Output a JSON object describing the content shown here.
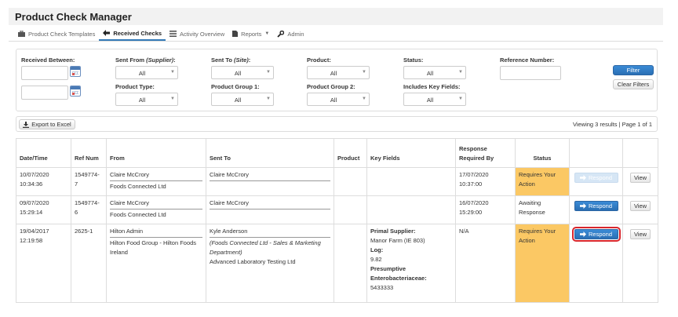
{
  "app": {
    "title": "Product Check Manager"
  },
  "nav": [
    {
      "label": "Product Check Templates",
      "icon": "briefcase-icon"
    },
    {
      "label": "Received Checks",
      "icon": "arrow-left-icon",
      "active": true
    },
    {
      "label": "Activity Overview",
      "icon": "list-icon"
    },
    {
      "label": "Reports",
      "icon": "file-icon",
      "dropdown": true
    },
    {
      "label": "Admin",
      "icon": "wrench-icon"
    }
  ],
  "filters": {
    "received_between": {
      "label": "Received Between:"
    },
    "sent_from": {
      "label": "Sent From ",
      "label_em": "(Supplier)",
      "label_tail": ":",
      "value": "All"
    },
    "sent_to": {
      "label": "Sent To ",
      "label_em": "(Site)",
      "label_tail": ":",
      "value": "All"
    },
    "product": {
      "label": "Product:",
      "value": "All"
    },
    "status": {
      "label": "Status:",
      "value": "All"
    },
    "reference_number": {
      "label": "Reference Number:",
      "value": ""
    },
    "product_type": {
      "label": "Product Type:",
      "value": "All"
    },
    "product_group_1": {
      "label": "Product Group 1:",
      "value": "All"
    },
    "product_group_2": {
      "label": "Product Group 2:",
      "value": "All"
    },
    "includes_key_fields": {
      "label": "Includes Key Fields:",
      "value": "All"
    },
    "filter_button": "Filter",
    "clear_button": "Clear Filters"
  },
  "toolbar": {
    "export_label": "Export to Excel",
    "results_info": "Viewing 3 results | Page 1 of 1"
  },
  "table": {
    "headers": {
      "datetime": "Date/Time",
      "ref": "Ref Num",
      "from": "From",
      "sent_to": "Sent To",
      "product": "Product",
      "key_fields": "Key Fields",
      "response_required": "Response Required By",
      "status": "Status"
    },
    "rows": [
      {
        "date": "10/07/2020",
        "time": "10:34:36",
        "ref_a": "1549774-",
        "ref_b": "7",
        "from_name": "Claire McCrory",
        "from_org": "Foods Connected Ltd",
        "to_name": "Claire McCrory",
        "resp_date": "17/07/2020",
        "resp_time": "10:37:00",
        "status_1": "Requires Your",
        "status_2": "Action",
        "respond": "Respond",
        "view": "View"
      },
      {
        "date": "09/07/2020",
        "time": "15:29:14",
        "ref_a": "1549774-",
        "ref_b": "6",
        "from_name": "Claire McCrory",
        "from_org": "Foods Connected Ltd",
        "to_name": "Claire McCrory",
        "resp_date": "16/07/2020",
        "resp_time": "15:29:00",
        "status_1": "Awaiting",
        "status_2": "Response",
        "respond": "Respond",
        "view": "View"
      },
      {
        "date": "19/04/2017",
        "time": "12:19:58",
        "ref": "2625-1",
        "from_name": "Hilton Admin",
        "from_org_1": "Hilton Food Group - Hilton Foods",
        "from_org_2": "Ireland",
        "to_name": "Kyle Anderson",
        "to_dept_1": "(Foods Connected Ltd - Sales & Marketing",
        "to_dept_2": "Department)",
        "to_org": "Advanced Laboratory Testing Ltd",
        "kf_label_1": "Primal Supplier:",
        "kf_value_1": "Manor Farm (IE 803)",
        "kf_label_2": "Log:",
        "kf_value_2": "9.82",
        "kf_label_3a": "Presumptive",
        "kf_label_3b": "Enterobacteriaceae:",
        "kf_value_3": "5433333",
        "resp": "N/A",
        "status_1": "Requires Your",
        "status_2": "Action",
        "respond": "Respond",
        "view": "View"
      }
    ]
  },
  "colors": {
    "primary": "#337ab7",
    "status_requires_action": "#fbc864",
    "highlight": "#d9262c"
  }
}
